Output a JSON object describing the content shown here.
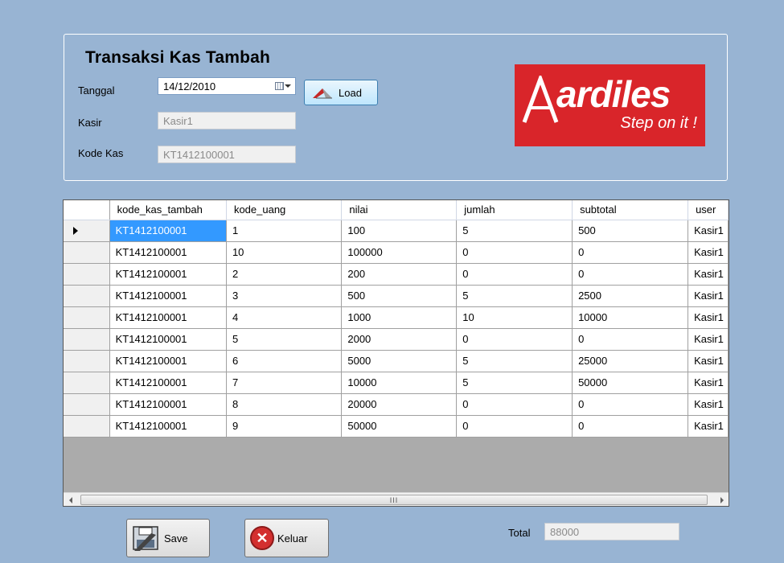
{
  "form": {
    "title": "Transaksi Kas Tambah",
    "tanggal_label": "Tanggal",
    "tanggal_value": "14/12/2010",
    "kasir_label": "Kasir",
    "kasir_value": "Kasir1",
    "kode_kas_label": "Kode Kas",
    "kode_kas_value": "KT1412100001",
    "load_label": "Load"
  },
  "logo": {
    "brand": "ardiles",
    "tagline": "Step on it !",
    "color": "#d9252a"
  },
  "grid": {
    "columns": [
      "kode_kas_tambah",
      "kode_uang",
      "nilai",
      "jumlah",
      "subtotal",
      "user"
    ],
    "selected_row": 0,
    "selection_color": "#3399ff",
    "rows": [
      [
        "KT1412100001",
        "1",
        "100",
        "5",
        "500",
        "Kasir1"
      ],
      [
        "KT1412100001",
        "10",
        "100000",
        "0",
        "0",
        "Kasir1"
      ],
      [
        "KT1412100001",
        "2",
        "200",
        "0",
        "0",
        "Kasir1"
      ],
      [
        "KT1412100001",
        "3",
        "500",
        "5",
        "2500",
        "Kasir1"
      ],
      [
        "KT1412100001",
        "4",
        "1000",
        "10",
        "10000",
        "Kasir1"
      ],
      [
        "KT1412100001",
        "5",
        "2000",
        "0",
        "0",
        "Kasir1"
      ],
      [
        "KT1412100001",
        "6",
        "5000",
        "5",
        "25000",
        "Kasir1"
      ],
      [
        "KT1412100001",
        "7",
        "10000",
        "5",
        "50000",
        "Kasir1"
      ],
      [
        "KT1412100001",
        "8",
        "20000",
        "0",
        "0",
        "Kasir1"
      ],
      [
        "KT1412100001",
        "9",
        "50000",
        "0",
        "0",
        "Kasir1"
      ]
    ],
    "scroll_thumb_glyph": "III"
  },
  "footer": {
    "save_label": "Save",
    "keluar_label": "Keluar",
    "total_label": "Total",
    "total_value": "88000"
  },
  "icons": {
    "calendar": "calendar-icon",
    "load": "load-icon",
    "save": "save-icon",
    "keluar": "close-icon"
  },
  "colors": {
    "background": "#98B4D3"
  }
}
